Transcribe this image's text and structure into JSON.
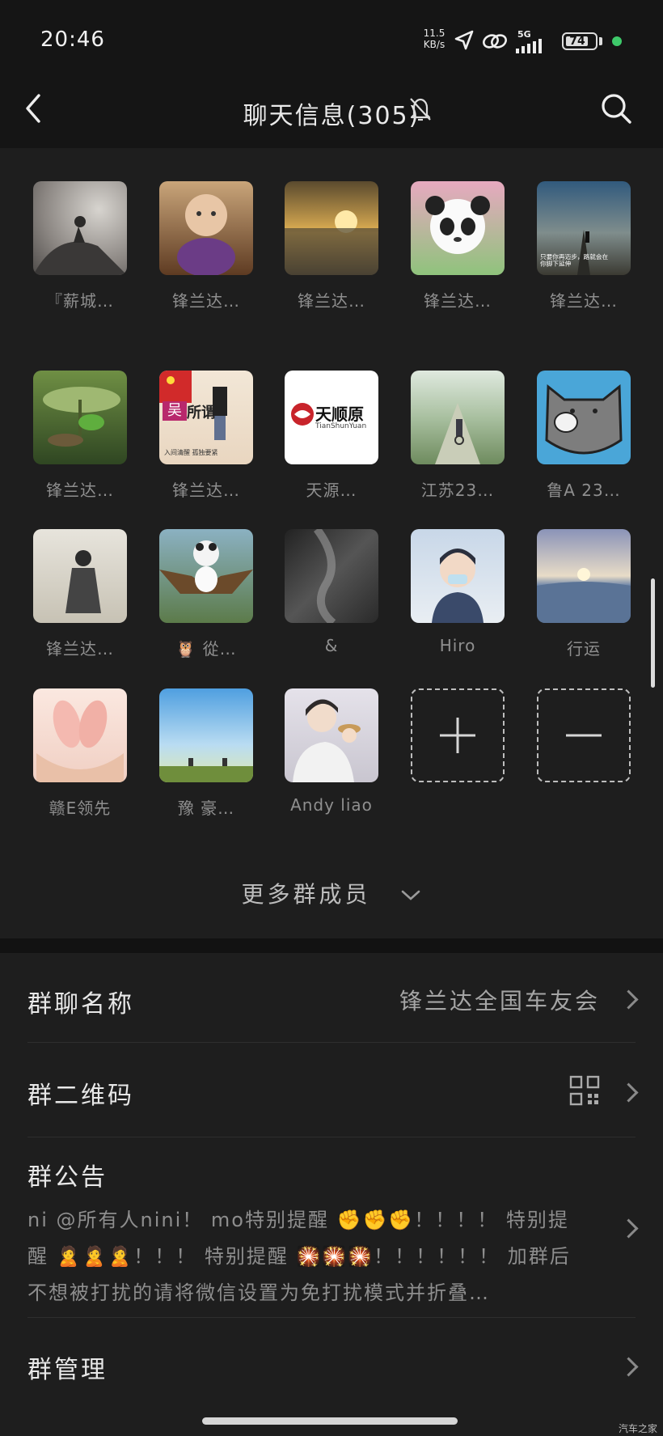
{
  "status_bar": {
    "time": "20:46",
    "net_speed": "11.5 KB/s",
    "network": "5G",
    "battery": "74"
  },
  "header": {
    "title": "聊天信息(305)"
  },
  "members": [
    {
      "name": "『薪城…"
    },
    {
      "name": "锋兰达…"
    },
    {
      "name": "锋兰达…"
    },
    {
      "name": "锋兰达…"
    },
    {
      "name": "锋兰达…"
    },
    {
      "name": "锋兰达…"
    },
    {
      "name": "锋兰达…"
    },
    {
      "name": "天源…"
    },
    {
      "name": "江苏23…"
    },
    {
      "name": "鲁A 23…"
    },
    {
      "name": "锋兰达…"
    },
    {
      "name": "🦉 從…"
    },
    {
      "name": "&"
    },
    {
      "name": "Hiro"
    },
    {
      "name": "行运"
    },
    {
      "name": "赣E领先"
    },
    {
      "name": "豫 豪…"
    },
    {
      "name": "Andy liao"
    }
  ],
  "avatar_texts": {
    "wu": "吴",
    "suowei": "所谓",
    "suowei_sub": "入间清醒 孤独要紧",
    "tianshunyuan": "天顺原",
    "tianshunyuan_en": "TianShunYuan",
    "road_text": "只要你再迈步，路就会在你脚下延伸"
  },
  "more_members": "更多群成员",
  "settings": {
    "group_name_label": "群聊名称",
    "group_name_value": "锋兰达全国车友会",
    "qr_label": "群二维码",
    "notice_label": "群公告",
    "notice_text": "ni @所有人nini！ mo特别提醒 ✊✊✊！！！！ 特别提醒 🙎🙎🙎！！！ 特别提醒 🎇🎇🎇！！！！！！ 加群后不想被打扰的请将微信设置为免打扰模式并折叠…",
    "manage_label": "群管理"
  },
  "watermark": "汽车之家"
}
